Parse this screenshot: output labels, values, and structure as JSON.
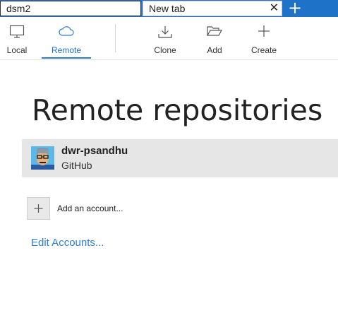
{
  "tabs": [
    {
      "label": "dsm2"
    },
    {
      "label": "New tab",
      "close_glyph": "✕"
    }
  ],
  "tab_add_glyph": "+",
  "toolbar": {
    "local": {
      "label": "Local",
      "icon": "monitor-icon"
    },
    "remote": {
      "label": "Remote",
      "icon": "cloud-icon"
    },
    "clone": {
      "label": "Clone",
      "icon": "download-icon"
    },
    "add": {
      "label": "Add",
      "icon": "folder-open-icon"
    },
    "create": {
      "label": "Create",
      "icon": "plus-icon"
    }
  },
  "page": {
    "title": "Remote repositories"
  },
  "accounts": [
    {
      "name": "dwr-psandhu",
      "provider": "GitHub",
      "avatar": "avatar-image"
    }
  ],
  "add_account": {
    "label": "Add an account...",
    "icon": "plus-icon"
  },
  "edit_accounts": {
    "label": "Edit Accounts..."
  },
  "colors": {
    "accent": "#1e73c8",
    "link": "#2b7fd4",
    "selected_row": "#e6e6e6"
  }
}
